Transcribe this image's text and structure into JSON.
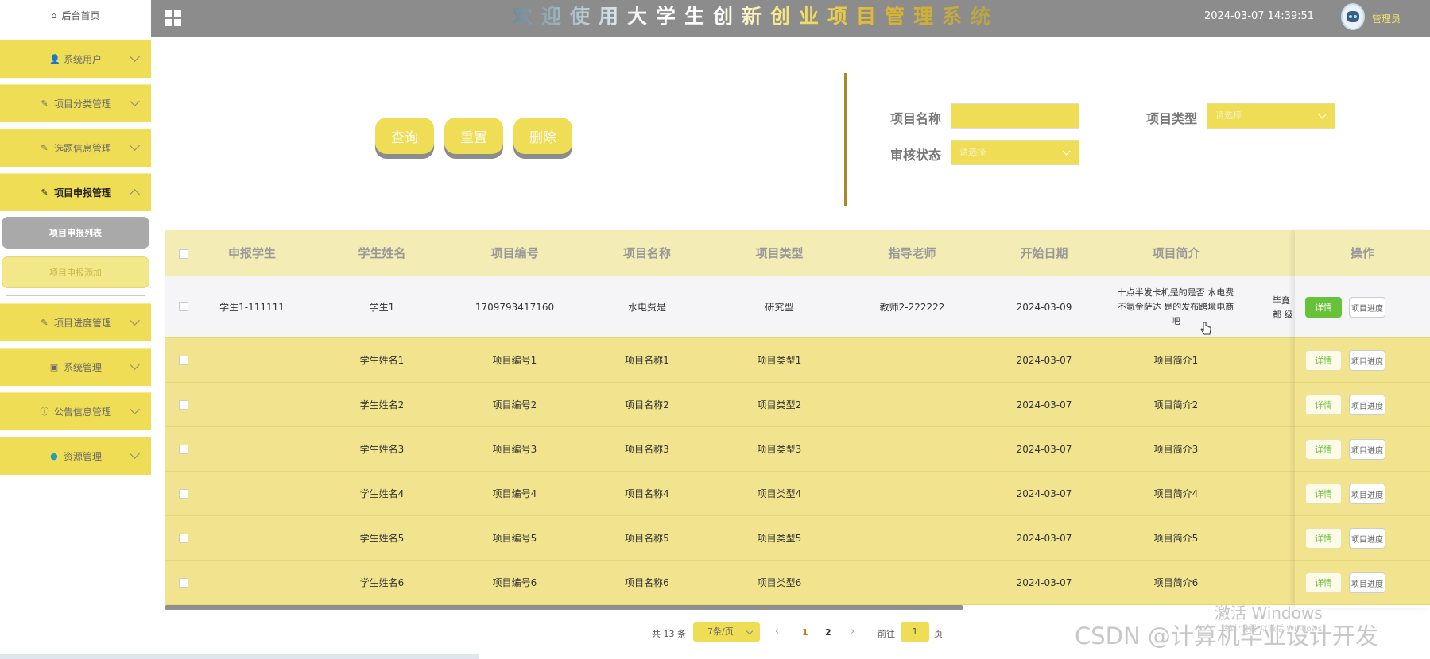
{
  "header": {
    "title": "欢迎使用大学生创新创业项目管理系统",
    "datetime": "2024-03-07 14:39:51",
    "user": "管理员"
  },
  "sidebar": {
    "home": "后台首页",
    "items": [
      {
        "label": "系统用户",
        "icon": "user-icon"
      },
      {
        "label": "项目分类管理",
        "icon": "edit-icon"
      },
      {
        "label": "选题信息管理",
        "icon": "edit-icon"
      },
      {
        "label": "项目申报管理",
        "icon": "edit-icon"
      },
      {
        "label": "项目进度管理",
        "icon": "edit-icon"
      },
      {
        "label": "系统管理",
        "icon": "image-icon"
      },
      {
        "label": "公告信息管理",
        "icon": "info-icon"
      },
      {
        "label": "资源管理",
        "icon": "location-icon"
      }
    ],
    "sub_items": [
      "项目申报列表",
      "项目申报添加"
    ]
  },
  "actions": {
    "query": "查询",
    "reset": "重置",
    "delete": "删除"
  },
  "filters": {
    "name_label": "项目名称",
    "type_label": "项目类型",
    "status_label": "审核状态",
    "type_placeholder": "请选择",
    "status_placeholder": "请选择"
  },
  "table": {
    "columns": [
      "申报学生",
      "学生姓名",
      "项目编号",
      "项目名称",
      "项目类型",
      "指导老师",
      "开始日期",
      "项目简介",
      "操作"
    ],
    "rows": [
      {
        "student": "学生1-111111",
        "name": "学生1",
        "code": "1709793417160",
        "project": "水电费是",
        "type": "研究型",
        "teacher": "教师2-222222",
        "date": "2024-03-09",
        "intro": "十点半发卡机是的是否 水电费不氪金萨达 是的发布跨境电商吧",
        "overflow": "毕竟都 级"
      },
      {
        "student": "",
        "name": "学生姓名1",
        "code": "项目编号1",
        "project": "项目名称1",
        "type": "项目类型1",
        "teacher": "",
        "date": "2024-03-07",
        "intro": "项目简介1",
        "overflow": ""
      },
      {
        "student": "",
        "name": "学生姓名2",
        "code": "项目编号2",
        "project": "项目名称2",
        "type": "项目类型2",
        "teacher": "",
        "date": "2024-03-07",
        "intro": "项目简介2",
        "overflow": ""
      },
      {
        "student": "",
        "name": "学生姓名3",
        "code": "项目编号3",
        "project": "项目名称3",
        "type": "项目类型3",
        "teacher": "",
        "date": "2024-03-07",
        "intro": "项目简介3",
        "overflow": ""
      },
      {
        "student": "",
        "name": "学生姓名4",
        "code": "项目编号4",
        "project": "项目名称4",
        "type": "项目类型4",
        "teacher": "",
        "date": "2024-03-07",
        "intro": "项目简介4",
        "overflow": ""
      },
      {
        "student": "",
        "name": "学生姓名5",
        "code": "项目编号5",
        "project": "项目名称5",
        "type": "项目类型5",
        "teacher": "",
        "date": "2024-03-07",
        "intro": "项目简介5",
        "overflow": ""
      },
      {
        "student": "",
        "name": "学生姓名6",
        "code": "项目编号6",
        "project": "项目名称6",
        "type": "项目类型6",
        "teacher": "",
        "date": "2024-03-07",
        "intro": "项目简介6",
        "overflow": ""
      }
    ],
    "detail_label": "详情",
    "progress_label": "项目进度"
  },
  "pagination": {
    "total": "共 13 条",
    "page_size": "7条/页",
    "pages": [
      "1",
      "2"
    ],
    "goto_label": "前往",
    "goto_value": "1",
    "unit": "页"
  },
  "watermarks": {
    "activate": "激活 Windows",
    "activate_sub": "转到\"设置\"以激活 Windows。",
    "csdn": "CSDN @计算机毕业设计开发"
  },
  "colors": {
    "accent": "#eedd55",
    "header": "#8c8c8c",
    "row": "#f2e48f",
    "success": "#67c23a"
  }
}
